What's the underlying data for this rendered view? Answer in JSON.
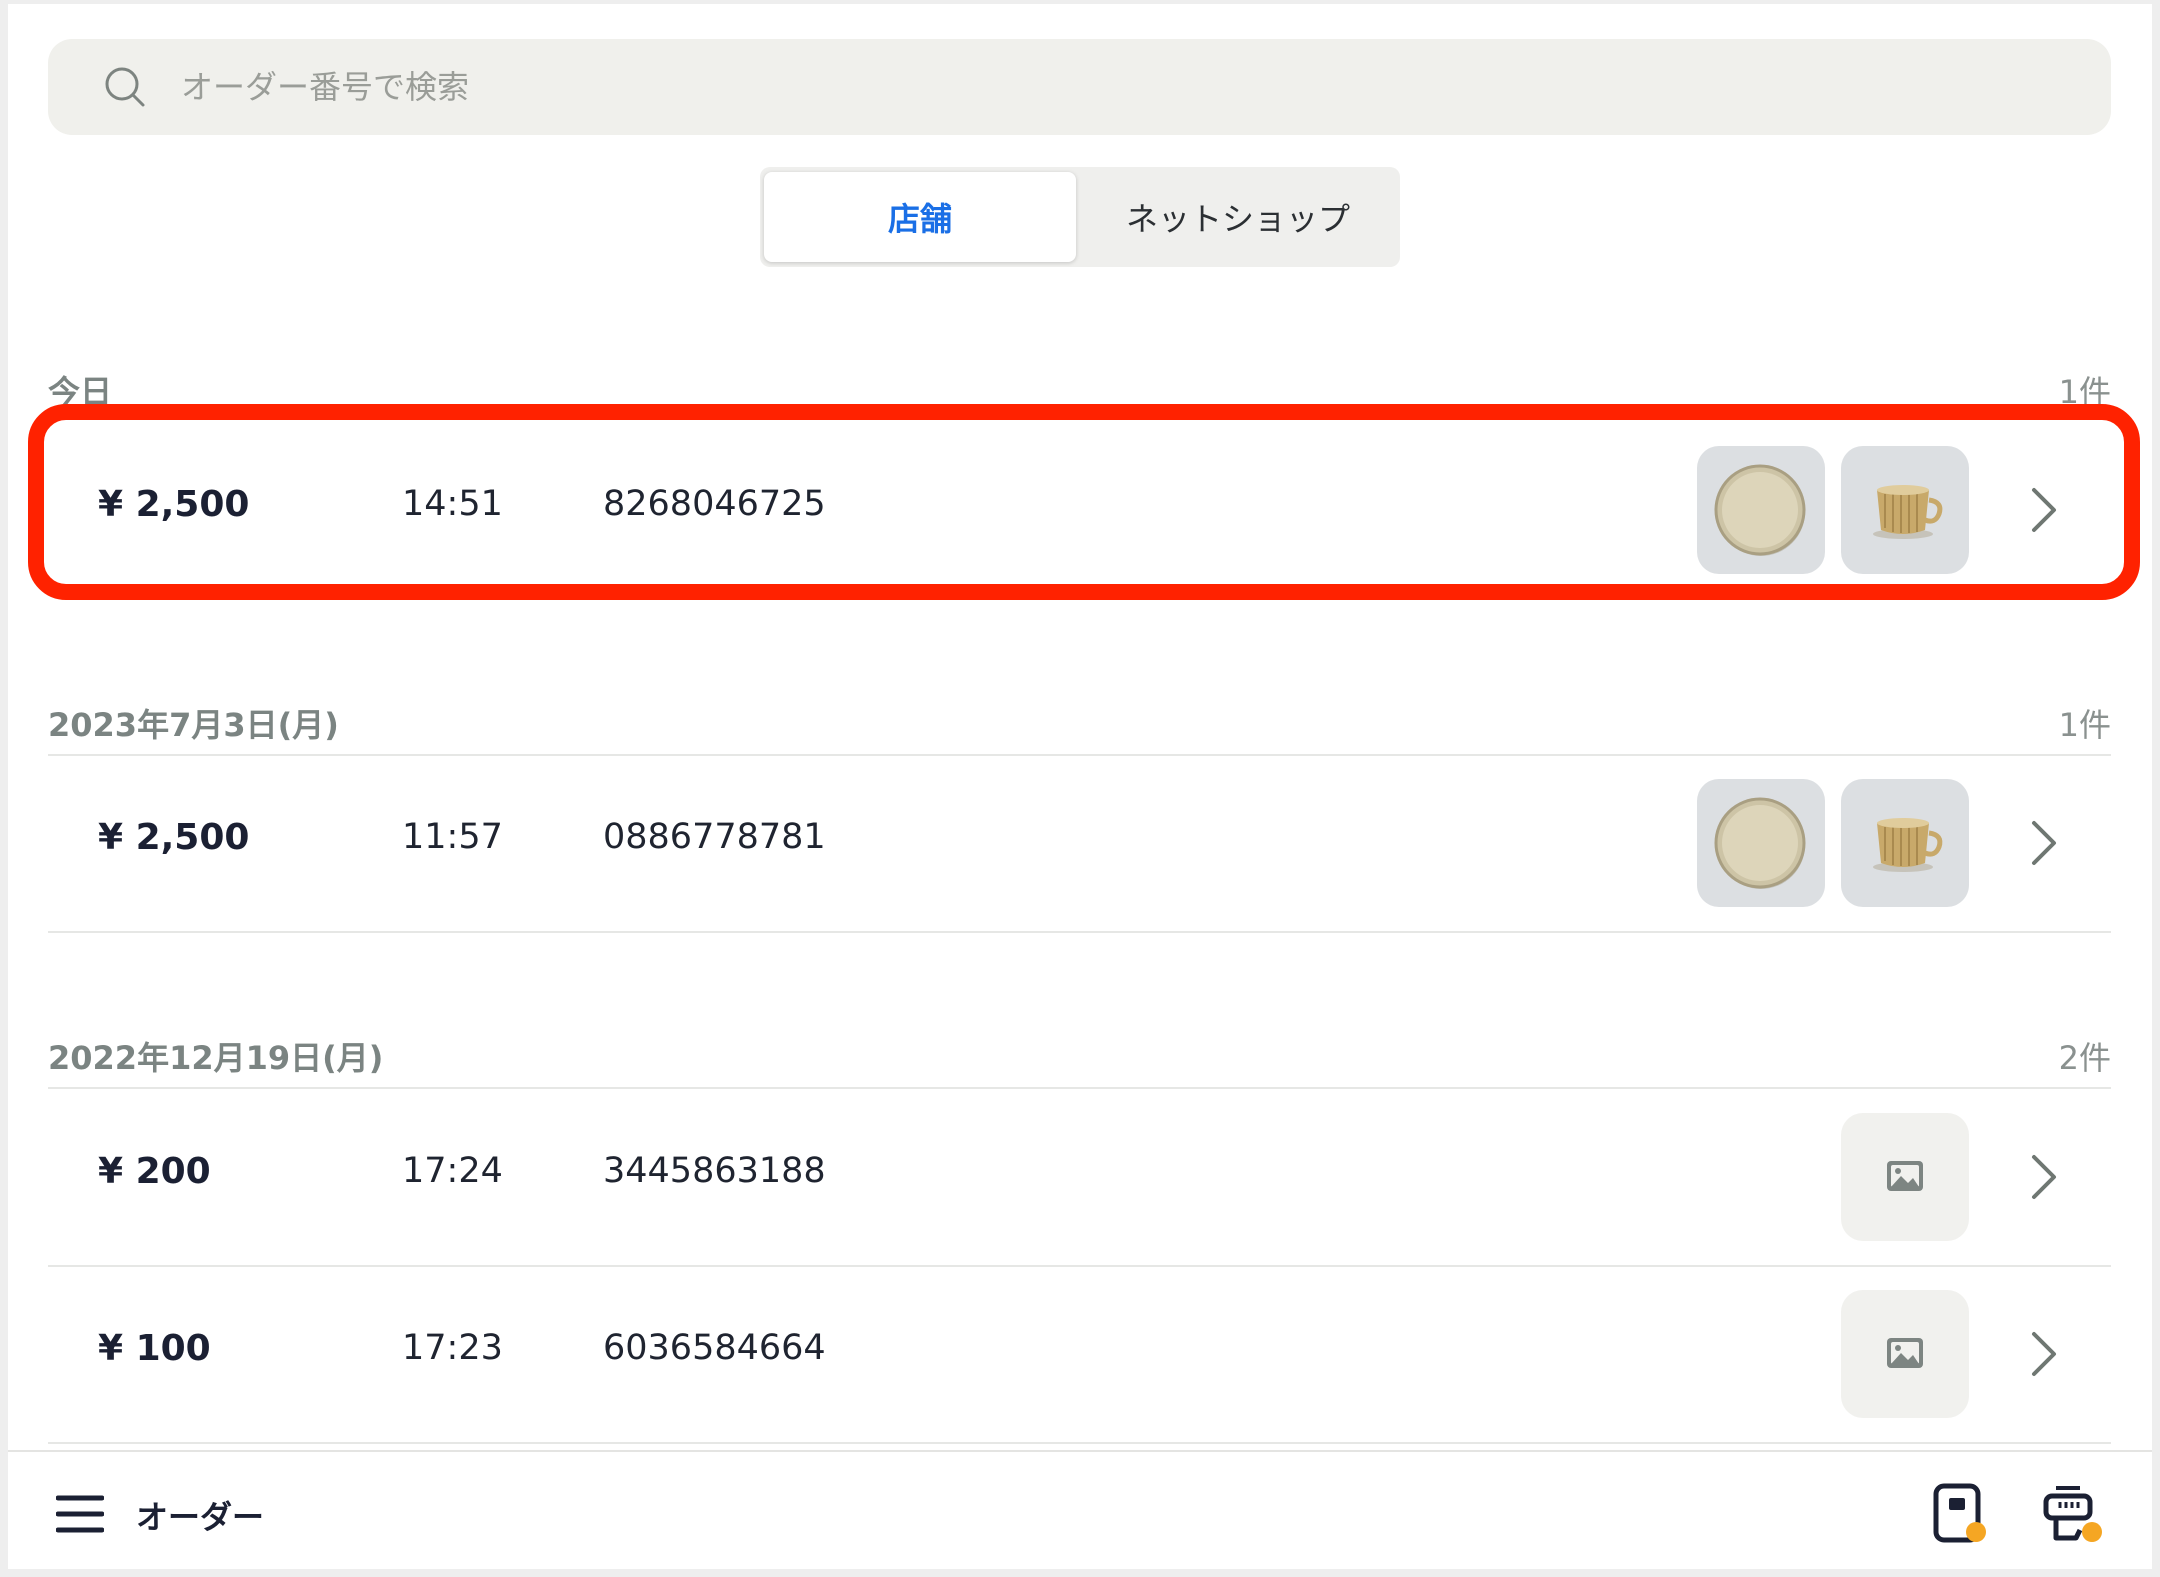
{
  "search": {
    "placeholder": "オーダー番号で検索"
  },
  "tabs": {
    "store": "店舗",
    "netshop": "ネットショップ"
  },
  "sections": [
    {
      "title": "今日",
      "count": "1件",
      "orders": [
        {
          "price": "¥ 2,500",
          "time": "14:51",
          "order_no": "8268046725",
          "thumbs": [
            "plate-thumbnail",
            "cup-thumbnail"
          ]
        }
      ]
    },
    {
      "title": "2023年7月3日(月)",
      "count": "1件",
      "orders": [
        {
          "price": "¥ 2,500",
          "time": "11:57",
          "order_no": "0886778781",
          "thumbs": [
            "plate-thumbnail",
            "cup-thumbnail"
          ]
        }
      ]
    },
    {
      "title": "2022年12月19日(月)",
      "count": "2件",
      "orders": [
        {
          "price": "¥ 200",
          "time": "17:24",
          "order_no": "3445863188",
          "thumbs": [
            "image-placeholder-icon"
          ]
        },
        {
          "price": "¥ 100",
          "time": "17:23",
          "order_no": "6036584664",
          "thumbs": [
            "image-placeholder-icon"
          ]
        }
      ]
    }
  ],
  "bottom_bar": {
    "title": "オーダー"
  },
  "icons": {
    "search": "search-icon",
    "chevron": "chevron-right-icon",
    "menu": "menu-icon",
    "reader": "card-reader-icon",
    "printer": "receipt-printer-icon"
  },
  "colors": {
    "accent": "#1a6fe6",
    "highlight": "#ff2200",
    "status_dot": "#f5a623"
  }
}
